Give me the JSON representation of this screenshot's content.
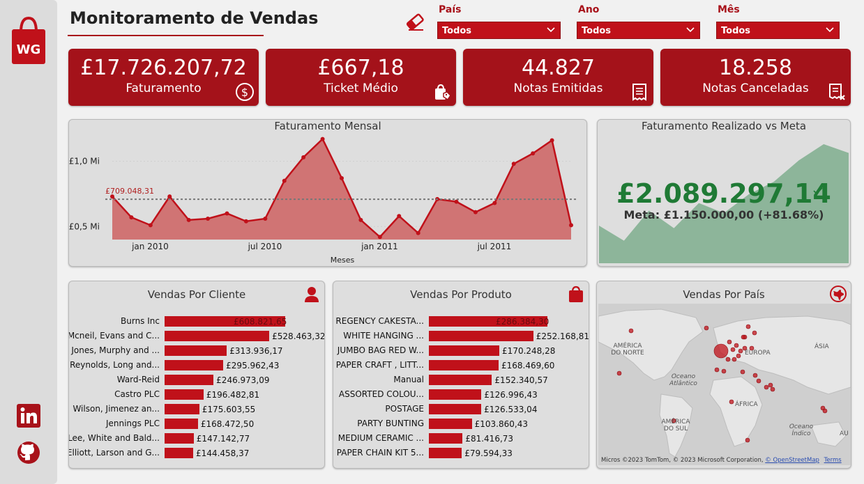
{
  "app": {
    "title": "Monitoramento de Vendas",
    "logo_text": "WG"
  },
  "filters": [
    {
      "label": "País",
      "value": "Todos"
    },
    {
      "label": "Ano",
      "value": "Todos"
    },
    {
      "label": "Mês",
      "value": "Todos"
    }
  ],
  "kpis": [
    {
      "value": "£17.726.207,72",
      "label": "Faturamento",
      "icon": "dollar-circle-icon"
    },
    {
      "value": "£667,18",
      "label": "Ticket Médio",
      "icon": "shopping-bag-tag-icon"
    },
    {
      "value": "44.827",
      "label": "Notas Emitidas",
      "icon": "receipt-icon"
    },
    {
      "value": "18.258",
      "label": "Notas Canceladas",
      "icon": "receipt-cancel-icon"
    }
  ],
  "monthly": {
    "title": "Faturamento Mensal",
    "xlabel": "Meses",
    "avg_label": "£709.048,31",
    "y_ticks": [
      "£1,0 Mi",
      "£0,5 Mi"
    ],
    "x_ticks": [
      "jan 2010",
      "jul 2010",
      "jan 2011",
      "jul 2011"
    ]
  },
  "meta": {
    "title": "Faturamento Realizado vs Meta",
    "value": "£2.089.297,14",
    "target": "Meta: £1.150.000,00 (+81.68%)"
  },
  "clients": {
    "title": "Vendas Por Cliente",
    "rows": [
      {
        "name": "Burns Inc",
        "value": "£608.821,65",
        "v": 608821.65
      },
      {
        "name": "Mcneil, Evans and C...",
        "value": "£528.463,32",
        "v": 528463.32
      },
      {
        "name": "Jones, Murphy and ...",
        "value": "£313.936,17",
        "v": 313936.17
      },
      {
        "name": "Reynolds, Long and...",
        "value": "£295.962,43",
        "v": 295962.43
      },
      {
        "name": "Ward-Reid",
        "value": "£246.973,09",
        "v": 246973.09
      },
      {
        "name": "Castro PLC",
        "value": "£196.482,81",
        "v": 196482.81
      },
      {
        "name": "Wilson, Jimenez an...",
        "value": "£175.603,55",
        "v": 175603.55
      },
      {
        "name": "Jennings PLC",
        "value": "£168.472,50",
        "v": 168472.5
      },
      {
        "name": "Lee, White and Bald...",
        "value": "£147.142,77",
        "v": 147142.77
      },
      {
        "name": "Elliott, Larson and G...",
        "value": "£144.458,37",
        "v": 144458.37
      }
    ]
  },
  "products": {
    "title": "Vendas Por Produto",
    "rows": [
      {
        "name": "REGENCY CAKESTA...",
        "value": "£286.384,30",
        "v": 286384.3
      },
      {
        "name": "WHITE HANGING ...",
        "value": "£252.168,81",
        "v": 252168.81
      },
      {
        "name": "JUMBO BAG RED W...",
        "value": "£170.248,28",
        "v": 170248.28
      },
      {
        "name": "PAPER CRAFT , LITT...",
        "value": "£168.469,60",
        "v": 168469.6
      },
      {
        "name": "Manual",
        "value": "£152.340,57",
        "v": 152340.57
      },
      {
        "name": "ASSORTED COLOU...",
        "value": "£126.996,43",
        "v": 126996.43
      },
      {
        "name": "POSTAGE",
        "value": "£126.533,04",
        "v": 126533.04
      },
      {
        "name": "PARTY BUNTING",
        "value": "£103.860,43",
        "v": 103860.43
      },
      {
        "name": "MEDIUM CERAMIC ...",
        "value": "£81.416,73",
        "v": 81416.73
      },
      {
        "name": "PAPER CHAIN KIT 5...",
        "value": "£79.594,33",
        "v": 79594.33
      }
    ]
  },
  "map": {
    "title": "Vendas Por País",
    "labels": {
      "na": "AMÉRICA DO NORTE",
      "eu": "EUROPA",
      "asia": "ÁSIA",
      "atl": "Oceano Atlântico",
      "af": "ÁFRICA",
      "sa": "AMÉRICA DO SUL",
      "ind": "Oceano Índico",
      "au": "AU"
    },
    "attribution_prefix": "Micros",
    "attribution": "©2023 TomTom, © 2023 Microsoft Corporation,",
    "attribution_link": "© OpenStreetMap",
    "terms": "Terms"
  },
  "chart_data": [
    {
      "type": "area",
      "title": "Faturamento Mensal",
      "xlabel": "Meses",
      "x": [
        "2009-12",
        "2010-01",
        "2010-02",
        "2010-03",
        "2010-04",
        "2010-05",
        "2010-06",
        "2010-07",
        "2010-08",
        "2010-09",
        "2010-10",
        "2010-11",
        "2010-12",
        "2011-01",
        "2011-02",
        "2011-03",
        "2011-04",
        "2011-05",
        "2011-06",
        "2011-07",
        "2011-08",
        "2011-09",
        "2011-10",
        "2011-11",
        "2011-12"
      ],
      "values": [
        0.73,
        0.57,
        0.51,
        0.73,
        0.55,
        0.56,
        0.6,
        0.54,
        0.56,
        0.85,
        1.03,
        1.17,
        0.87,
        0.55,
        0.42,
        0.58,
        0.45,
        0.71,
        0.69,
        0.61,
        0.68,
        0.98,
        1.06,
        1.16,
        0.51
      ],
      "average": 0.709,
      "ylim": [
        0.4,
        1.2
      ]
    },
    {
      "type": "area",
      "title": "Faturamento Realizado vs Meta",
      "values": [
        0.3,
        0.18,
        0.42,
        0.28,
        0.48,
        0.4,
        0.55,
        0.65,
        0.82,
        0.95,
        0.88
      ]
    }
  ]
}
